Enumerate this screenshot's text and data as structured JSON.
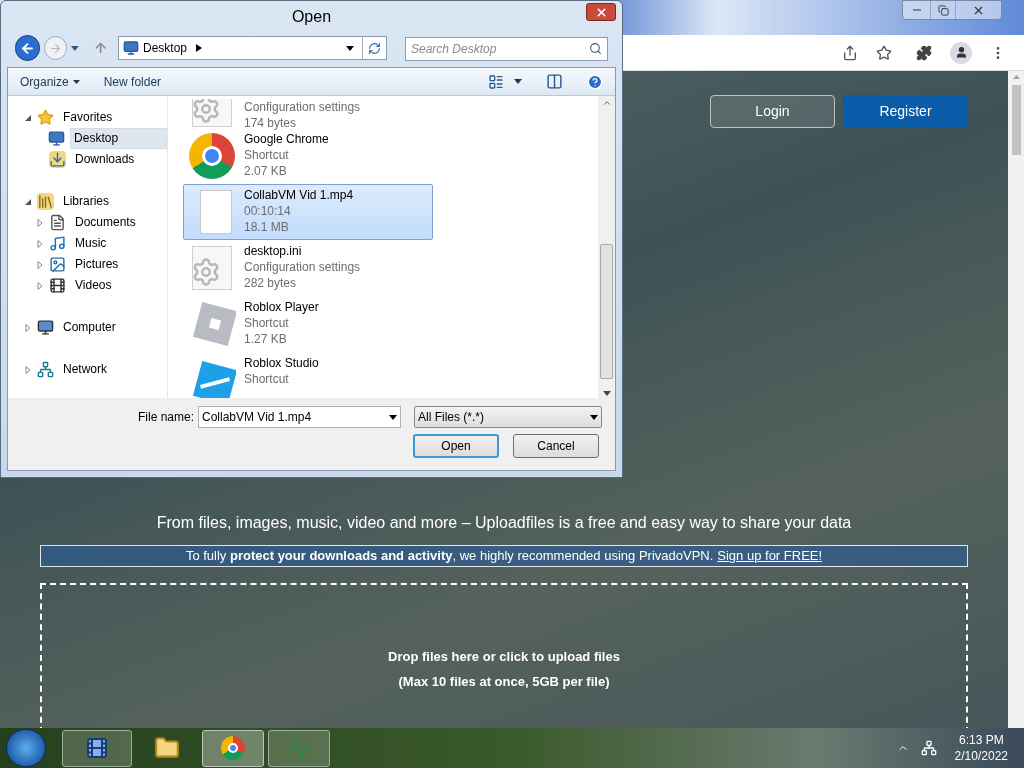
{
  "page": {
    "nav_buttons": [
      {
        "label": "Login",
        "kind": "outline"
      },
      {
        "label": "Register",
        "kind": "primary"
      }
    ],
    "subtitle": "From files, images, music, video and more – Uploadfiles is a free and easy way to share your data",
    "notice": {
      "text": "To fully **protect your downloads and activity**, we highly recommended using PrivadoVPN.",
      "link": "Sign up for FREE!"
    },
    "dropzone": {
      "title": "Drop files here or click to upload files",
      "hint": "(Max 10 files at once, 5GB per file)"
    }
  },
  "dialog": {
    "title": "Open",
    "address": "Desktop",
    "search": {
      "placeholder": "Search Desktop"
    },
    "commands": [
      {
        "label": "Organize",
        "kind": "menu"
      },
      {
        "label": "New folder",
        "kind": "plain"
      }
    ],
    "tree": [
      {
        "label": "Favorites",
        "kind": "star",
        "expanded": true,
        "selected": false,
        "children": [
          {
            "label": "Desktop",
            "kind": "desktop",
            "selected": true
          },
          {
            "label": "Downloads",
            "kind": "downloads",
            "selected": false
          }
        ]
      },
      {
        "label": "Libraries",
        "kind": "libraries",
        "expanded": true,
        "selected": false,
        "children": [
          {
            "label": "Documents",
            "kind": "documents",
            "expanded": false,
            "selected": false
          },
          {
            "label": "Music",
            "kind": "music",
            "expanded": false,
            "selected": false
          },
          {
            "label": "Pictures",
            "kind": "pictures",
            "expanded": false,
            "selected": false
          },
          {
            "label": "Videos",
            "kind": "videos",
            "expanded": false,
            "selected": false
          }
        ]
      },
      {
        "label": "Computer",
        "kind": "computer",
        "expanded": false,
        "selected": false
      },
      {
        "label": "Network",
        "kind": "network",
        "expanded": false,
        "selected": false
      }
    ],
    "files": [
      {
        "kind": "settings",
        "details": [
          "Configuration settings",
          "174 bytes"
        ],
        "selected": false
      },
      {
        "kind": "chrome",
        "name": "Google Chrome",
        "details": [
          "Shortcut",
          "2.07 KB"
        ],
        "selected": false
      },
      {
        "kind": "blank",
        "name": "CollabVM Vid 1.mp4",
        "details": [
          "00:10:14",
          "18.1 MB"
        ],
        "selected": true
      },
      {
        "kind": "settings",
        "name": "desktop.ini",
        "details": [
          "Configuration settings",
          "282 bytes"
        ],
        "selected": false
      },
      {
        "kind": "player",
        "name": "Roblox Player",
        "details": [
          "Shortcut",
          "1.27 KB"
        ],
        "selected": false
      },
      {
        "kind": "studio",
        "name": "Roblox Studio",
        "details": [
          "Shortcut"
        ],
        "selected": false
      }
    ],
    "file_name_label": "File name:",
    "file_name": "CollabVM Vid 1.mp4",
    "file_type": "All Files (*.*)",
    "buttons": [
      {
        "label": "Open",
        "kind": "default"
      },
      {
        "label": "Cancel",
        "kind": "plain"
      }
    ]
  },
  "taskbar": {
    "time": "6:13 PM",
    "date": "2/10/2022"
  }
}
